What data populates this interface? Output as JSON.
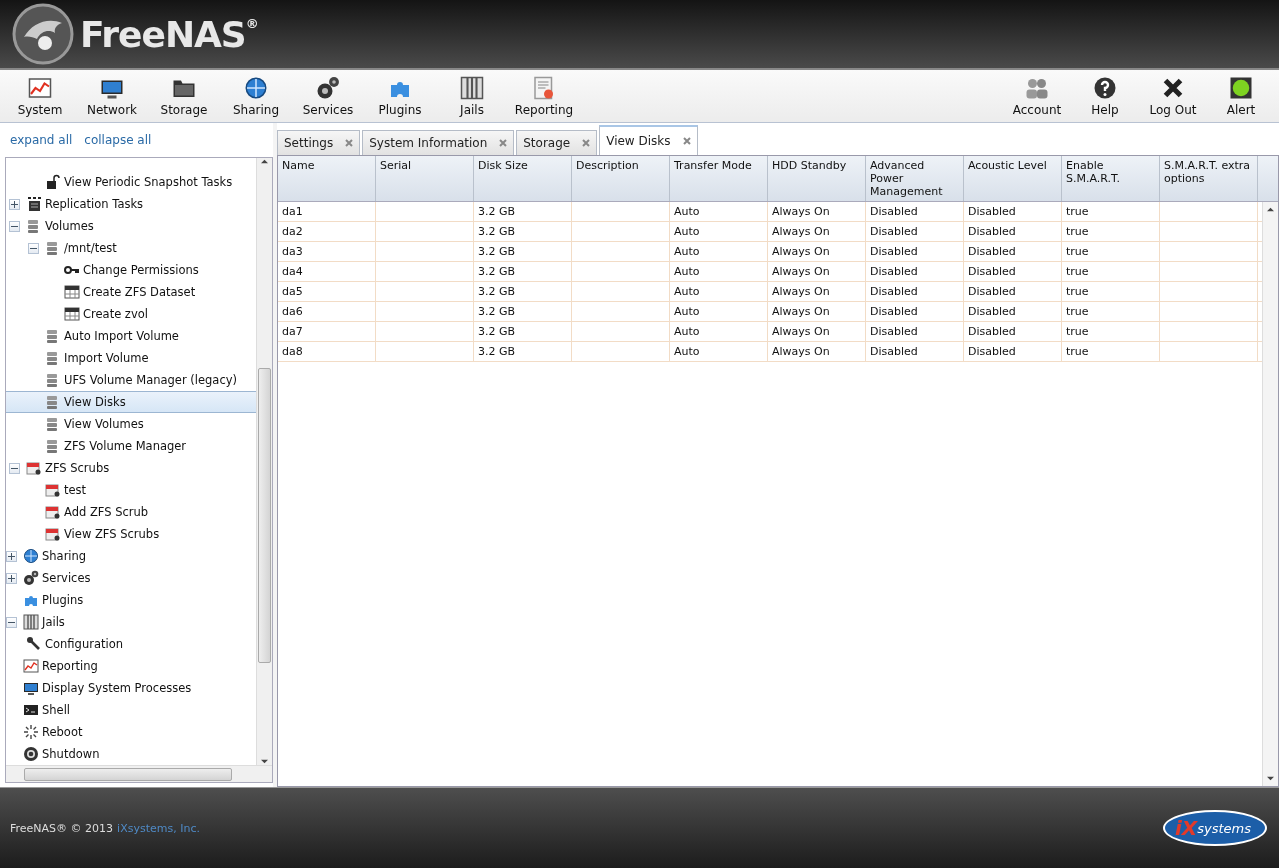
{
  "header": {
    "logo": "FreeNAS$^{®}$"
  },
  "toolbar": {
    "left": [
      {
        "label": "System",
        "kind": "chart"
      },
      {
        "label": "Network",
        "kind": "monitor"
      },
      {
        "label": "Storage",
        "kind": "folder"
      },
      {
        "label": "Sharing",
        "kind": "globe"
      },
      {
        "label": "Services",
        "kind": "gears"
      },
      {
        "label": "Plugins",
        "kind": "puzzle"
      },
      {
        "label": "Jails",
        "kind": "bars"
      },
      {
        "label": "Reporting",
        "kind": "document"
      }
    ],
    "right": [
      {
        "label": "Account",
        "kind": "people"
      },
      {
        "label": "Help",
        "kind": "help"
      },
      {
        "label": "Log Out",
        "kind": "cross"
      },
      {
        "label": "Alert",
        "kind": "light"
      }
    ]
  },
  "sidebar": {
    "links": [
      "expand all",
      "collapse all"
    ],
    "tree": [
      {
        "children": [
          {
            "children": [
              {
                "label": "View Periodic Snapshot Tasks",
                "kind": "lock",
                "selected": false
              }
            ]
          },
          {
            "label": "Replication Tasks",
            "kind": "list",
            "expanded": false,
            "selected": false
          },
          {
            "label": "Volumes",
            "kind": "disk",
            "expanded": true,
            "selected": false,
            "children": [
              {
                "label": "/mnt/test",
                "kind": "disk",
                "expanded": true,
                "selected": false,
                "children": [
                  {
                    "label": "Change Permissions",
                    "kind": "key",
                    "selected": false
                  },
                  {
                    "label": "Create ZFS Dataset",
                    "kind": "table",
                    "selected": false
                  },
                  {
                    "label": "Create zvol",
                    "kind": "table",
                    "selected": false
                  }
                ]
              },
              {
                "label": "Auto Import Volume",
                "kind": "disk",
                "selected": false
              },
              {
                "label": "Import Volume",
                "kind": "disk",
                "selected": false
              },
              {
                "label": "UFS Volume Manager (legacy)",
                "kind": "disk",
                "selected": false
              },
              {
                "label": "View Disks",
                "kind": "disk",
                "selected": true
              },
              {
                "label": "View Volumes",
                "kind": "disk",
                "selected": false
              },
              {
                "label": "ZFS Volume Manager",
                "kind": "disk",
                "selected": false
              }
            ]
          },
          {
            "label": "ZFS Scrubs",
            "kind": "calendar",
            "expanded": true,
            "selected": false,
            "children": [
              {
                "label": "test",
                "kind": "calendar",
                "selected": false
              },
              {
                "label": "Add ZFS Scrub",
                "kind": "calendar",
                "selected": false
              },
              {
                "label": "View ZFS Scrubs",
                "kind": "calendar",
                "selected": false
              }
            ]
          }
        ]
      },
      {
        "label": "Sharing",
        "kind": "globe",
        "expanded": false,
        "selected": false
      },
      {
        "label": "Services",
        "kind": "gears",
        "expanded": false,
        "selected": false
      },
      {
        "label": "Plugins",
        "kind": "puzzle",
        "selected": false
      },
      {
        "label": "Jails",
        "kind": "bars",
        "expanded": true,
        "selected": false,
        "children": [
          {
            "label": "Configuration",
            "kind": "wrench",
            "selected": false
          }
        ]
      },
      {
        "label": "Reporting",
        "kind": "chart",
        "selected": false
      },
      {
        "label": "Display System Processes",
        "kind": "monitor",
        "selected": false
      },
      {
        "label": "Shell",
        "kind": "terminal",
        "selected": false
      },
      {
        "label": "Reboot",
        "kind": "spinner",
        "selected": false
      },
      {
        "label": "Shutdown",
        "kind": "power",
        "selected": false
      }
    ]
  },
  "tabs": [
    {
      "label": "Settings",
      "selected": false
    },
    {
      "label": "System Information",
      "selected": false
    },
    {
      "label": "Storage",
      "selected": false
    },
    {
      "label": "View Disks",
      "selected": true
    }
  ],
  "table": {
    "columns": [
      "Name",
      "Serial",
      "Disk Size",
      "Description",
      "Transfer Mode",
      "HDD Standby",
      "Advanced Power Management",
      "Acoustic Level",
      "Enable S.M.A.R.T.",
      "S.M.A.R.T. extra options"
    ],
    "rows": [
      [
        "da1",
        "",
        "3.2 GB",
        "",
        "Auto",
        "Always On",
        "Disabled",
        "Disabled",
        "true",
        ""
      ],
      [
        "da2",
        "",
        "3.2 GB",
        "",
        "Auto",
        "Always On",
        "Disabled",
        "Disabled",
        "true",
        ""
      ],
      [
        "da3",
        "",
        "3.2 GB",
        "",
        "Auto",
        "Always On",
        "Disabled",
        "Disabled",
        "true",
        ""
      ],
      [
        "da4",
        "",
        "3.2 GB",
        "",
        "Auto",
        "Always On",
        "Disabled",
        "Disabled",
        "true",
        ""
      ],
      [
        "da5",
        "",
        "3.2 GB",
        "",
        "Auto",
        "Always On",
        "Disabled",
        "Disabled",
        "true",
        ""
      ],
      [
        "da6",
        "",
        "3.2 GB",
        "",
        "Auto",
        "Always On",
        "Disabled",
        "Disabled",
        "true",
        ""
      ],
      [
        "da7",
        "",
        "3.2 GB",
        "",
        "Auto",
        "Always On",
        "Disabled",
        "Disabled",
        "true",
        ""
      ],
      [
        "da8",
        "",
        "3.2 GB",
        "",
        "Auto",
        "Always On",
        "Disabled",
        "Disabled",
        "true",
        ""
      ]
    ]
  },
  "footer": {
    "text": "FreeNAS® © 2013",
    "link": "iXsystems, Inc.",
    "logo_mark": "iX",
    "logo_name": "systems"
  }
}
